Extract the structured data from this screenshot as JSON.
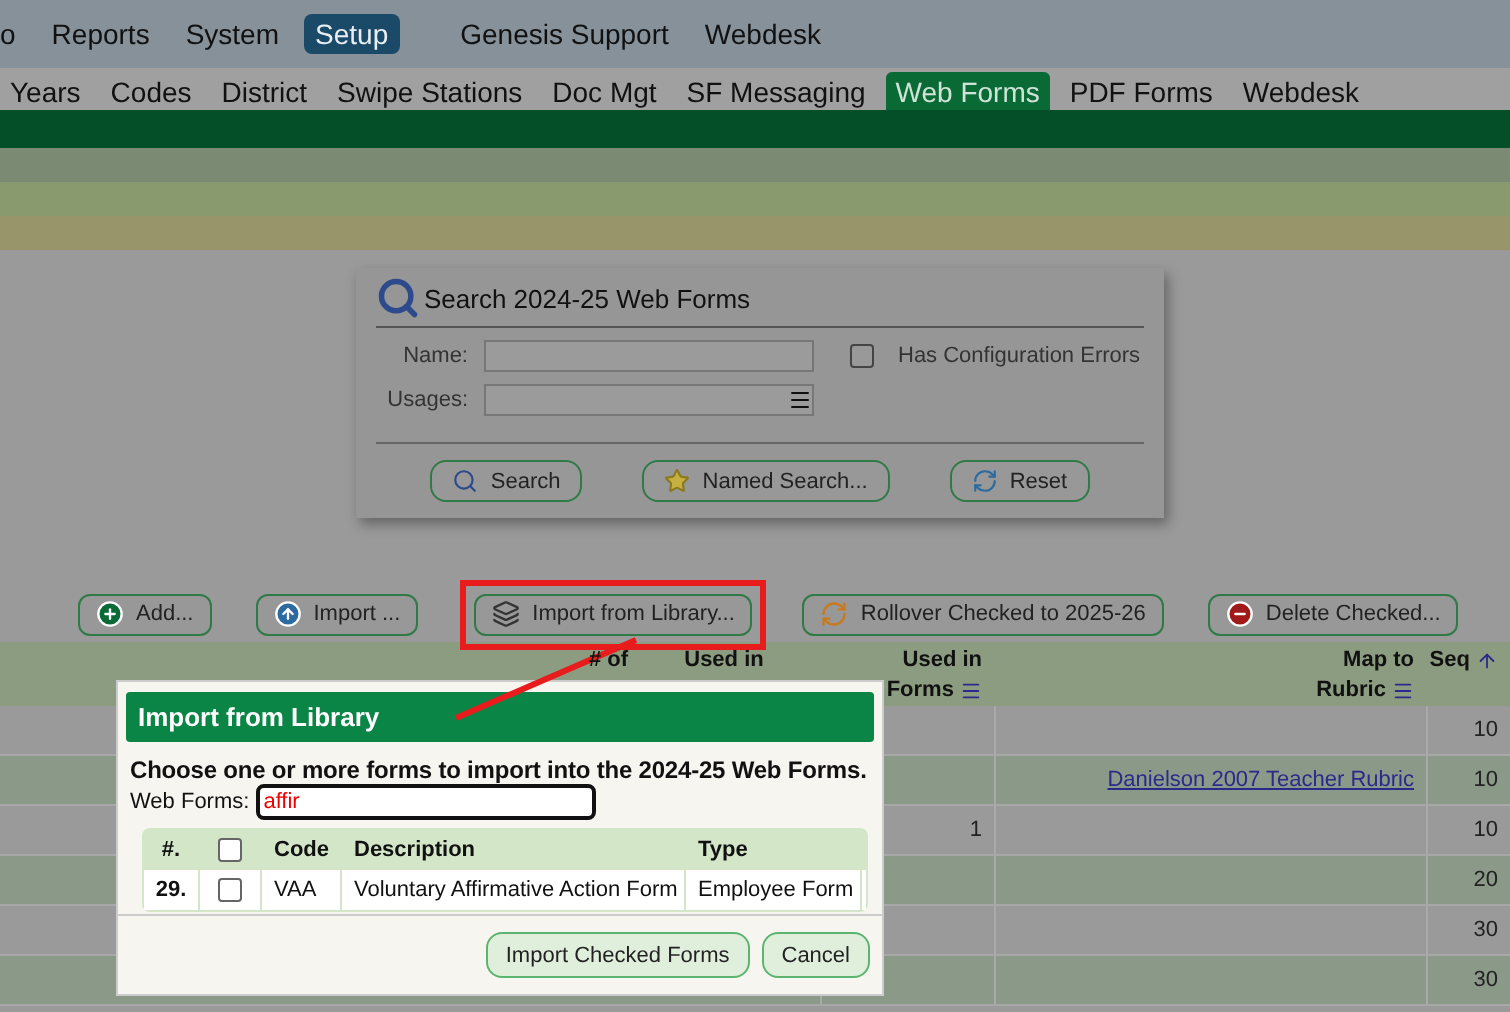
{
  "top_menu": [
    {
      "label": "o",
      "selected": false
    },
    {
      "label": "Reports",
      "selected": false
    },
    {
      "label": "System",
      "selected": false
    },
    {
      "label": "Setup",
      "selected": true
    },
    {
      "label": "Genesis Support",
      "selected": false
    },
    {
      "label": "Webdesk",
      "selected": false
    }
  ],
  "tabs": [
    {
      "label": "Years",
      "selected": false
    },
    {
      "label": "Codes",
      "selected": false
    },
    {
      "label": "District",
      "selected": false
    },
    {
      "label": "Swipe Stations",
      "selected": false
    },
    {
      "label": "Doc Mgt",
      "selected": false
    },
    {
      "label": "SF Messaging",
      "selected": false
    },
    {
      "label": "Web Forms",
      "selected": true
    },
    {
      "label": "PDF Forms",
      "selected": false
    },
    {
      "label": "Webdesk",
      "selected": false
    }
  ],
  "search_panel": {
    "title": "Search 2024-25 Web Forms",
    "name_label": "Name:",
    "usages_label": "Usages:",
    "config_errors": {
      "label": "Has Configuration Errors",
      "checked": false
    },
    "buttons": [
      "Search",
      "Named Search...",
      "Reset"
    ]
  },
  "actions": [
    {
      "label": "Add...",
      "highlighted": false
    },
    {
      "label": "Import ...",
      "highlighted": false
    },
    {
      "label": "Import from Library...",
      "highlighted": true
    },
    {
      "label": "Rollover Checked to 2025-26",
      "highlighted": false
    },
    {
      "label": "Delete Checked...",
      "highlighted": false
    }
  ],
  "table": {
    "columns": [
      {
        "lines": [
          "# of"
        ],
        "menu": false,
        "sorted": false
      },
      {
        "lines": [
          "Used in"
        ],
        "menu": false,
        "sorted": false
      },
      {
        "lines": [
          "Used in",
          "Forms"
        ],
        "menu": true,
        "sorted": false
      },
      {
        "lines": [
          "Map to",
          "Rubric"
        ],
        "menu": true,
        "sorted": false
      },
      {
        "lines": [
          "Seq"
        ],
        "menu": false,
        "sorted": true
      }
    ],
    "rows": [
      {
        "forms": "",
        "rubric": "",
        "seq": "10"
      },
      {
        "forms": "",
        "rubric": "Danielson 2007 Teacher Rubric",
        "seq": "10"
      },
      {
        "forms": "1",
        "rubric": "",
        "seq": "10"
      },
      {
        "forms": "",
        "rubric": "",
        "seq": "20"
      },
      {
        "forms": "",
        "rubric": "",
        "seq": "30"
      },
      {
        "forms": "",
        "rubric": "",
        "seq": "30"
      }
    ]
  },
  "dialog": {
    "title": "Import from Library",
    "instruction": "Choose one or more forms to import into the 2024-25 Web Forms.",
    "filter_label": "Web Forms:",
    "filter_value": "affir",
    "columns": [
      "#.",
      "Code",
      "Description",
      "Type"
    ],
    "header_checked": false,
    "rows": [
      {
        "number": "29.",
        "checked": false,
        "code": "VAA",
        "description": "Voluntary Affirmative Action Form",
        "type": "Employee Form"
      }
    ],
    "buttons": [
      "Import Checked Forms",
      "Cancel"
    ]
  }
}
